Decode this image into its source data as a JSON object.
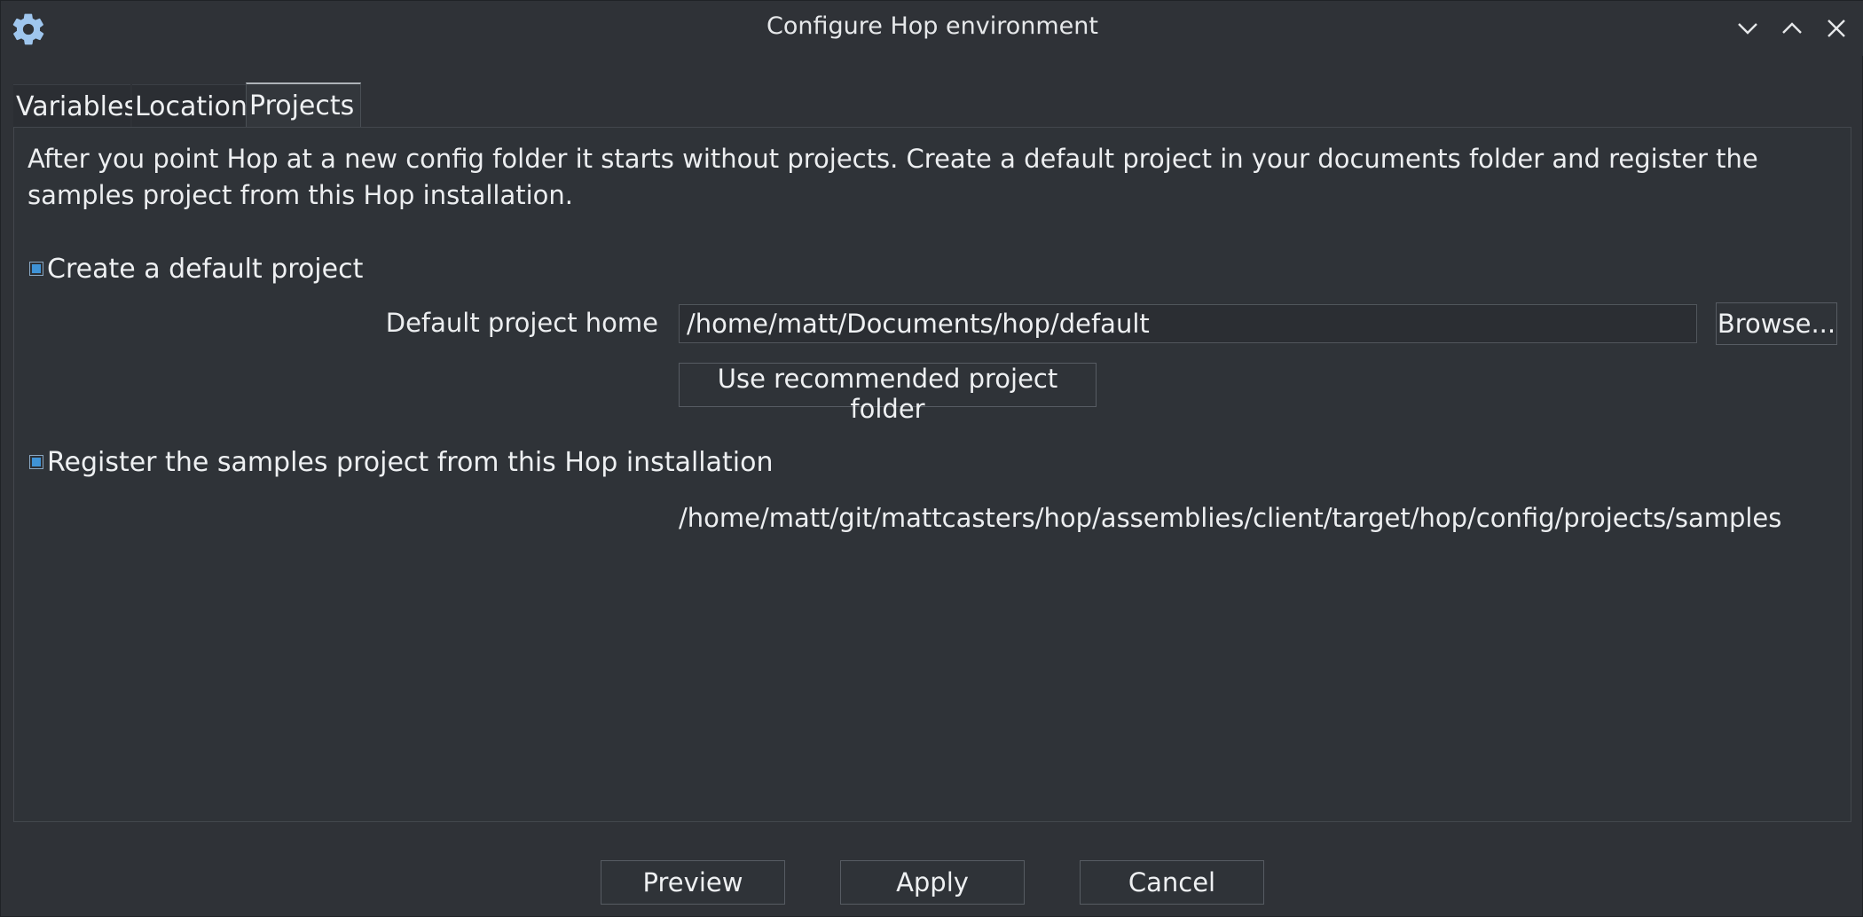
{
  "window": {
    "title": "Configure Hop environment",
    "icon": "gear-icon"
  },
  "tabs": [
    {
      "label": "Variables",
      "selected": false
    },
    {
      "label": "Location",
      "selected": false
    },
    {
      "label": "Projects",
      "selected": true
    }
  ],
  "projects": {
    "intro": "After you point Hop at a new config folder it starts without projects. Create a default project in your documents folder and register the samples project from this Hop installation.",
    "create_default": {
      "label": "Create a default project",
      "checked": true
    },
    "default_home": {
      "label": "Default project home",
      "value": "/home/matt/Documents/hop/default"
    },
    "browse_label": "Browse...",
    "recommended_label": "Use recommended project folder",
    "register_samples": {
      "label": "Register the samples project from this Hop installation",
      "checked": true
    },
    "samples_path": "/home/matt/git/mattcasters/hop/assemblies/client/target/hop/config/projects/samples"
  },
  "footer": {
    "preview_label": "Preview",
    "apply_label": "Apply",
    "cancel_label": "Cancel"
  },
  "colors": {
    "background": "#2f3237",
    "checkbox_accent": "#3f93d6",
    "gear_icon": "#9fc6ee"
  }
}
